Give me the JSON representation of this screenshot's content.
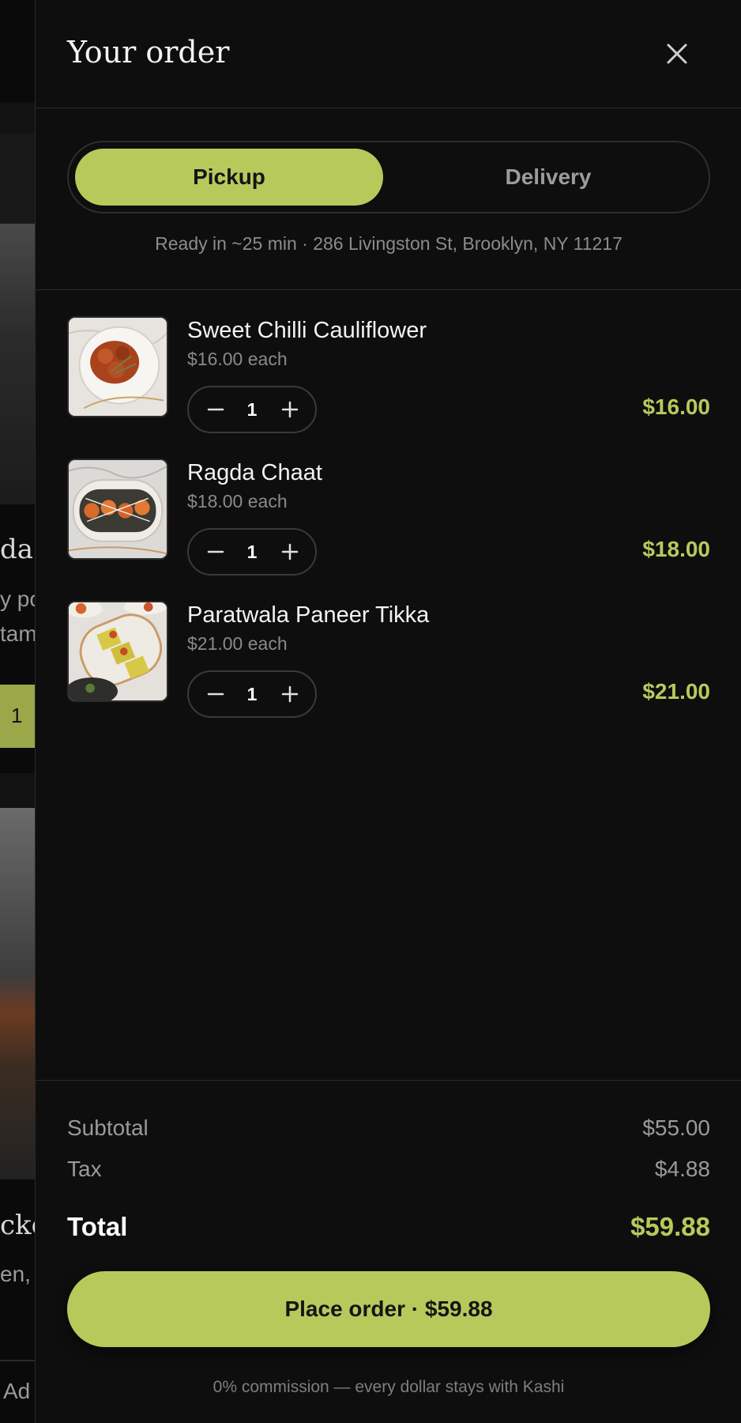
{
  "background_page": {
    "texts": [
      "da",
      "y po",
      "tam",
      "1",
      "cke",
      "en,",
      "Ad"
    ]
  },
  "drawer": {
    "title": "Your order",
    "close_icon": "close-icon"
  },
  "fulfillment": {
    "options": [
      {
        "label": "Pickup",
        "selected": true
      },
      {
        "label": "Delivery",
        "selected": false
      }
    ],
    "ready_info": "Ready in ~25 min · 286 Livingston St, Brooklyn, NY 11217"
  },
  "items": [
    {
      "name": "Sweet Chilli Cauliflower",
      "each": "$16.00 each",
      "qty": "1",
      "total": "$16.00"
    },
    {
      "name": "Ragda Chaat",
      "each": "$18.00 each",
      "qty": "1",
      "total": "$18.00"
    },
    {
      "name": "Paratwala Paneer Tikka",
      "each": "$21.00 each",
      "qty": "1",
      "total": "$21.00"
    }
  ],
  "summary": {
    "subtotal_label": "Subtotal",
    "subtotal_value": "$55.00",
    "tax_label": "Tax",
    "tax_value": "$4.88",
    "total_label": "Total",
    "total_value": "$59.88",
    "place_order_label": "Place order · $59.88",
    "commission_note": "0% commission — every dollar stays with Kashi"
  },
  "colors": {
    "accent": "#b8c95c",
    "background": "#0e0e0e",
    "muted_text": "#8c8c8c"
  }
}
